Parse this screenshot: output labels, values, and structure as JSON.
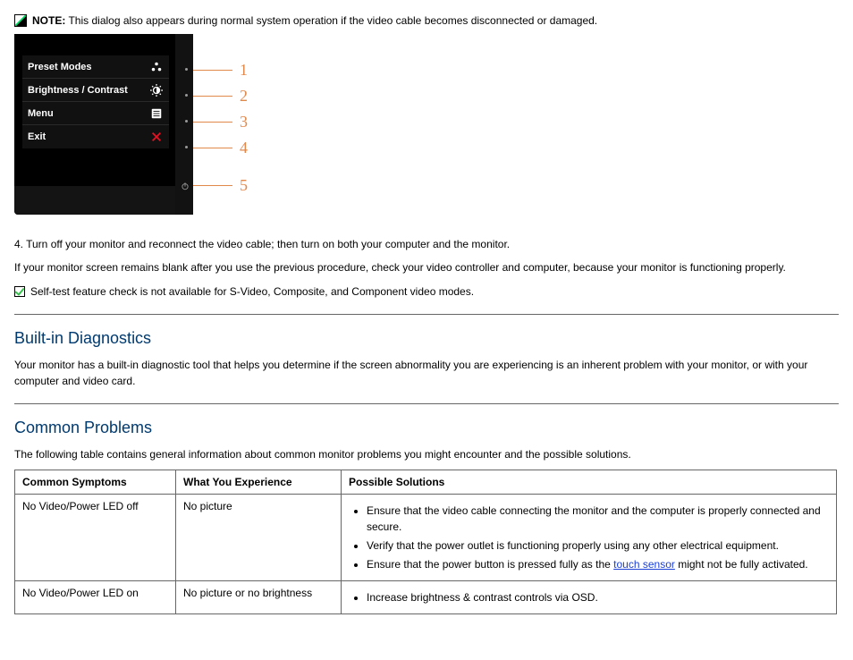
{
  "note": {
    "label": "NOTE:",
    "text": "This dialog also appears during normal system operation if the video cable becomes disconnected or damaged."
  },
  "osd": {
    "preset_modes": "Preset Modes",
    "brightness_contrast": "Brightness / Contrast",
    "menu": "Menu",
    "exit": "Exit"
  },
  "callouts": {
    "c1": "1",
    "c2": "2",
    "c3": "3",
    "c4": "4",
    "c5": "5"
  },
  "step4": "4. Turn off your monitor and reconnect the video cable; then turn on both your computer and the monitor.",
  "after_step": "If your monitor screen remains blank after you use the previous procedure, check your video controller and computer, because your monitor is functioning properly.",
  "check_note": "Self-test feature check is not available for S-Video, Composite, and Component video modes.",
  "builtin": {
    "heading": "Built-in Diagnostics",
    "para": "Your monitor has a built-in diagnostic tool that helps you determine if the screen abnormality you are experiencing is an inherent problem with your monitor, or with your computer and video card."
  },
  "common": {
    "heading": "Common Problems",
    "para": "The following table contains general information about common monitor problems you might encounter and the possible solutions."
  },
  "table": {
    "h1": "Common Symptoms",
    "h2": "What You Experience",
    "h3": "Possible Solutions",
    "r1c1": "No Video/Power LED off",
    "r1c2": "No picture",
    "r1c3a": "Ensure that the video cable connecting the monitor and the computer is properly connected and secure.",
    "r1c3b": "Verify that the power outlet is functioning properly using any other electrical equipment.",
    "r1c3c_a": "Ensure that the power button is pressed fully as the ",
    "r1c3c_link": "touch sensor",
    "r1c3c_b": " might not be fully activated.",
    "r2c1": "No Video/Power LED on",
    "r2c2": "No picture or no brightness",
    "r2c3a": "Increase brightness & contrast controls via OSD."
  }
}
